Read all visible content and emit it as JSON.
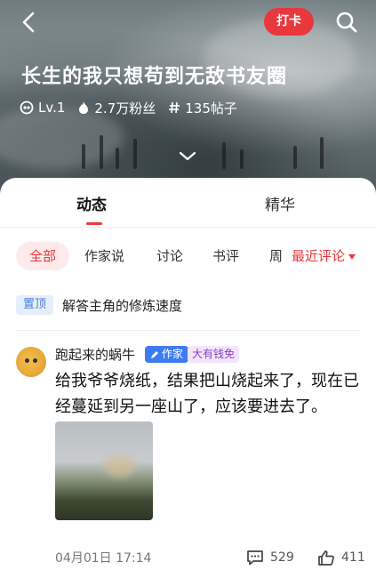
{
  "header": {
    "checkin_label": "打卡",
    "title": "长生的我只想苟到无敌书友圈",
    "level": "Lv.1",
    "followers": "2.7万粉丝",
    "posts": "135帖子"
  },
  "main_tabs": [
    {
      "label": "动态",
      "active": true
    },
    {
      "label": "精华",
      "active": false
    }
  ],
  "filters": {
    "items": [
      "全部",
      "作家说",
      "讨论",
      "书评",
      "周"
    ],
    "active": "全部",
    "sort_label": "最近评论"
  },
  "pinned": {
    "badge": "置顶",
    "text": "解答主角的修炼速度"
  },
  "post": {
    "username": "跑起来的蜗牛",
    "author_badge": "作家",
    "rich_badge": "大有钱免",
    "text": "给我爷爷烧纸，结果把山烧起来了，现在已经蔓延到另一座山了，应该要进去了。",
    "date": "04月01日 17:14",
    "comments": "529",
    "likes": "411"
  },
  "colors": {
    "accent": "#e8383d",
    "author_badge": "#3d7bf2",
    "pin_badge_text": "#4a7fd8"
  }
}
